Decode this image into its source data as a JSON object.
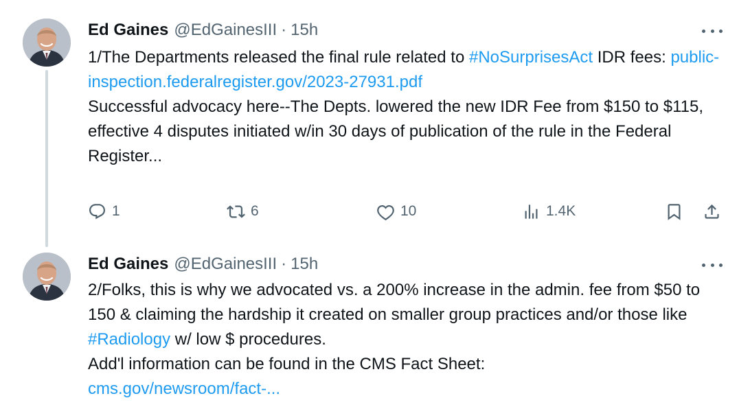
{
  "tweets": [
    {
      "author_name": "Ed Gaines",
      "handle": "@EdGainesIII",
      "separator": "·",
      "time": "15h",
      "text_before_hashtag": "1/The Departments released the final rule related to ",
      "hashtag": "#NoSurprisesAct",
      "text_after_hashtag": " IDR fees: ",
      "link": "public-inspection.federalregister.gov/2023-27931.pdf",
      "text_rest": "Successful advocacy here--The Depts. lowered the new IDR Fee from $150 to $115, effective 4 disputes initiated w/in 30 days of publication of the rule in the Federal Register...",
      "replies": "1",
      "reposts": "6",
      "likes": "10",
      "views": "1.4K"
    },
    {
      "author_name": "Ed Gaines",
      "handle": "@EdGainesIII",
      "separator": "·",
      "time": "15h",
      "text_before_hashtag": "2/Folks, this is why we advocated vs. a 200% increase in the admin. fee from $50 to 150 & claiming the hardship it created on smaller group practices and/or those like ",
      "hashtag": "#Radiology",
      "text_after_hashtag": " w/ low $ procedures.",
      "text_rest": "Add'l information can be found in the CMS Fact Sheet:",
      "link": "cms.gov/newsroom/fact-..."
    }
  ],
  "icons": {
    "more": "more-horizontal-icon",
    "reply": "reply-icon",
    "repost": "repost-icon",
    "like": "heart-icon",
    "views": "views-bar-chart-icon",
    "bookmark": "bookmark-icon",
    "share": "share-icon"
  },
  "colors": {
    "link": "#1d9bf0",
    "secondary_text": "#536471",
    "primary_text": "#0f1419",
    "thread_line": "#cfd9de"
  }
}
